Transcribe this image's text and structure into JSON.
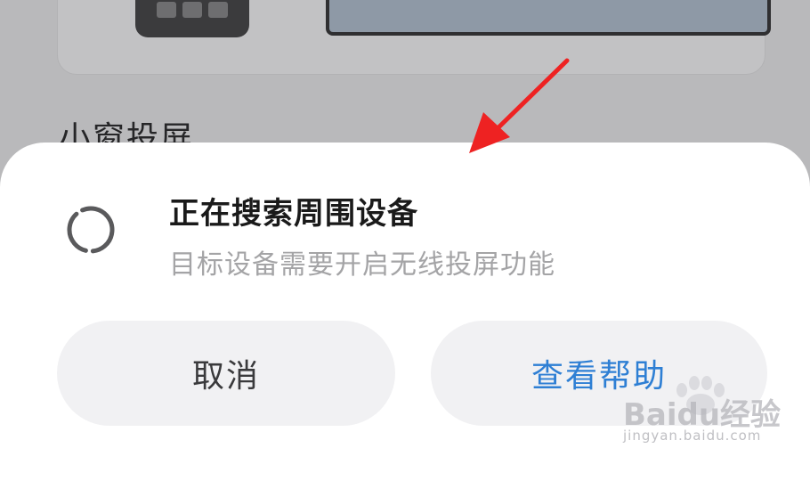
{
  "background": {
    "section_label": "小窗投屏"
  },
  "dialog": {
    "title": "正在搜索周围设备",
    "subtitle": "目标设备需要开启无线投屏功能",
    "cancel_label": "取消",
    "help_label": "查看帮助",
    "spinner_icon": "loading-spinner-icon",
    "accent_color": "#2e7fd4"
  },
  "annotation": {
    "arrow_color": "#ee2222"
  },
  "watermark": {
    "brand": "Baidu经验",
    "url": "jingyan.baidu.com"
  }
}
